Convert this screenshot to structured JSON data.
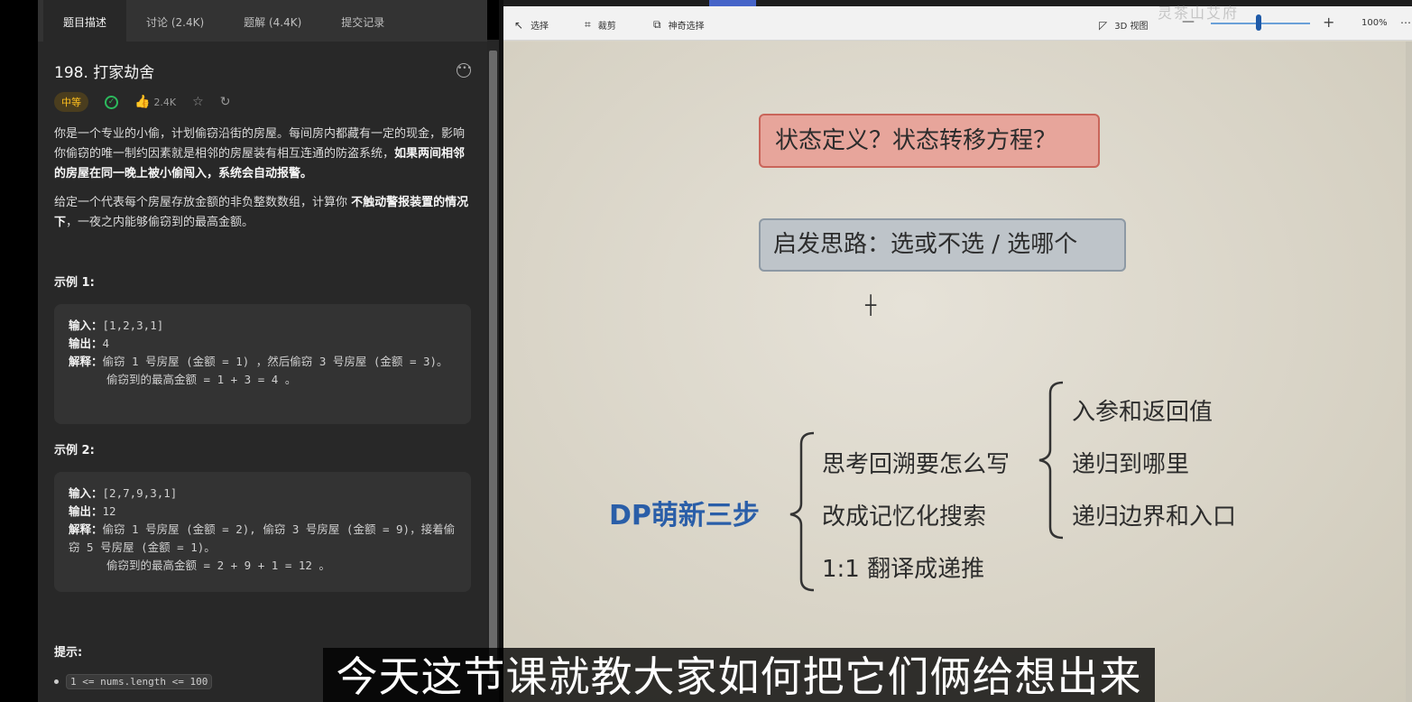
{
  "leetcode": {
    "tabs": [
      "题目描述",
      "讨论 (2.4K)",
      "题解 (4.4K)",
      "提交记录"
    ],
    "title": "198. 打家劫舍",
    "difficulty": "中等",
    "likes": "2.4K",
    "desc_p1_a": "你是一个专业的小偷，计划偷窃沿街的房屋。每间房内都藏有一定的现金，影响你偷窃的唯一制约因素就是相邻的房屋装有相互连通的防盗系统，",
    "desc_p1_b": "如果两间相邻的房屋在同一晚上被小偷闯入，系统会自动报警。",
    "desc_p2_a": "给定一个代表每个房屋存放金额的非负整数数组，计算你 ",
    "desc_p2_b": "不触动警报装置的情况下",
    "desc_p2_c": "，一夜之内能够偷窃到的最高金额。",
    "examples": [
      {
        "title": "示例 1:",
        "input_label": "输入：",
        "input": "[1,2,3,1]",
        "output_label": "输出：",
        "output": "4",
        "explain_label": "解释：",
        "explain": "偷窃 1 号房屋 (金额 = 1) ，然后偷窃 3 号房屋 (金额 = 3)。",
        "explain2": "偷窃到的最高金额 = 1 + 3 = 4 。"
      },
      {
        "title": "示例 2:",
        "input_label": "输入：",
        "input": "[2,7,9,3,1]",
        "output_label": "输出：",
        "output": "12",
        "explain_label": "解释：",
        "explain": "偷窃 1 号房屋 (金额 = 2), 偷窃 3 号房屋 (金额 = 9)，接着偷窃 5 号房屋 (金额 = 1)。",
        "explain2": "偷窃到的最高金额 = 2 + 9 + 1 = 12 。"
      }
    ],
    "hint_title": "提示:",
    "hint_item": "1 <= nums.length <= 100"
  },
  "app": {
    "tools": [
      "选择",
      "裁剪",
      "神奇选择"
    ],
    "view3d": "3D 视图",
    "zoom": "100%",
    "zoom_level": 0.5,
    "watermark": "灵茶山艾府"
  },
  "canvas": {
    "box1": "状态定义？状态转移方程？",
    "box2": "启发思路：选或不选 / 选哪个",
    "root": "DP萌新三步",
    "level1": [
      "思考回溯要怎么写",
      "改成记忆化搜索",
      "1:1 翻译成递推"
    ],
    "level2": [
      "入参和返回值",
      "递归到哪里",
      "递归边界和入口"
    ]
  },
  "subtitle": "今天这节课就教大家如何把它们俩给想出来"
}
